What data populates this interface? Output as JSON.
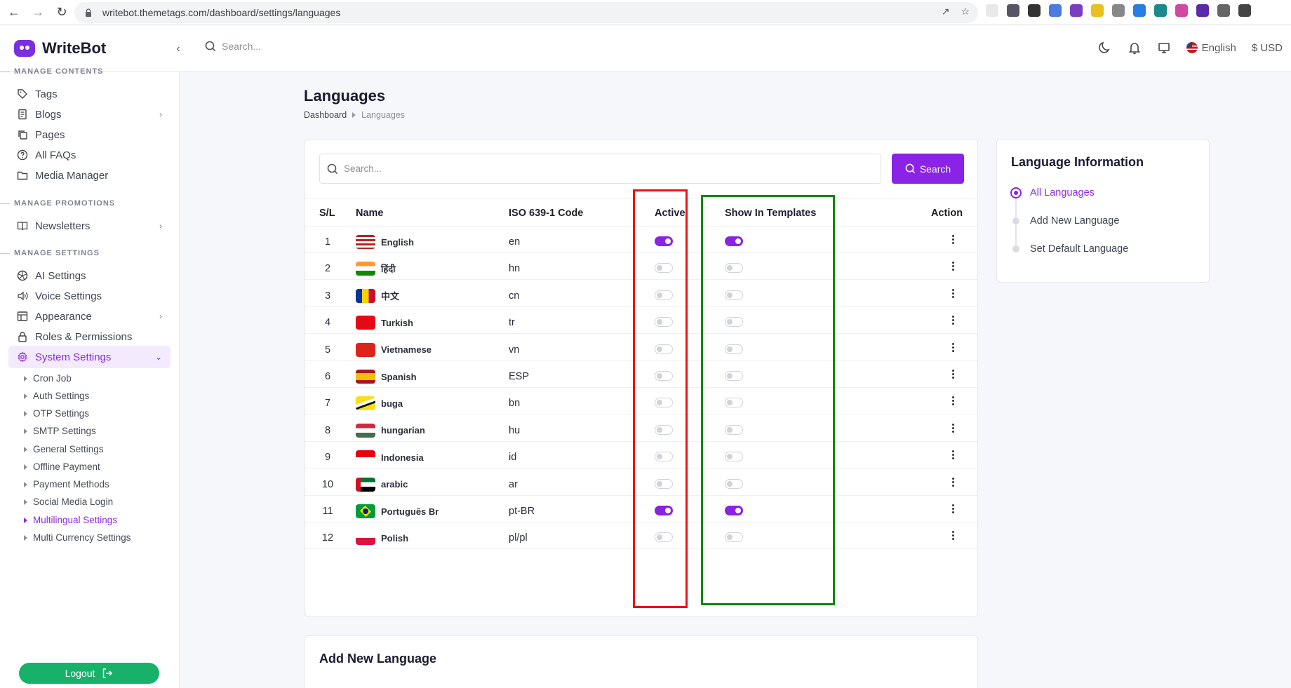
{
  "browser": {
    "url": "writebot.themetags.com/dashboard/settings/languages"
  },
  "header": {
    "brand": "WriteBot",
    "search_placeholder": "Search...",
    "language": "English",
    "currency": "$ USD"
  },
  "sidebar": {
    "sections": {
      "contents": "MANAGE CONTENTS",
      "promotions": "MANAGE PROMOTIONS",
      "settings": "MANAGE SETTINGS"
    },
    "items": {
      "tags": "Tags",
      "blogs": "Blogs",
      "pages": "Pages",
      "faqs": "All FAQs",
      "media": "Media Manager",
      "newsletters": "Newsletters",
      "ai": "AI Settings",
      "voice": "Voice Settings",
      "appearance": "Appearance",
      "roles": "Roles & Permissions",
      "system": "System Settings"
    },
    "subitems": [
      "Cron Job",
      "Auth Settings",
      "OTP Settings",
      "SMTP Settings",
      "General Settings",
      "Offline Payment",
      "Payment Methods",
      "Social Media Login",
      "Multilingual Settings",
      "Multi Currency Settings"
    ],
    "logout": "Logout"
  },
  "main": {
    "title": "Languages",
    "breadcrumb": {
      "home": "Dashboard",
      "current": "Languages"
    },
    "search_placeholder": "Search...",
    "search_button": "Search",
    "columns": {
      "sl": "S/L",
      "name": "Name",
      "code": "ISO 639-1 Code",
      "active": "Active",
      "templates": "Show In Templates",
      "action": "Action"
    },
    "rows": [
      {
        "sl": "1",
        "name": "English",
        "code": "en",
        "active": true,
        "templates": true
      },
      {
        "sl": "2",
        "name": "हिंदी",
        "code": "hn",
        "active": false,
        "templates": false
      },
      {
        "sl": "3",
        "name": "中文",
        "code": "cn",
        "active": false,
        "templates": false
      },
      {
        "sl": "4",
        "name": "Turkish",
        "code": "tr",
        "active": false,
        "templates": false
      },
      {
        "sl": "5",
        "name": "Vietnamese",
        "code": "vn",
        "active": false,
        "templates": false
      },
      {
        "sl": "6",
        "name": "Spanish",
        "code": "ESP",
        "active": false,
        "templates": false
      },
      {
        "sl": "7",
        "name": "buga",
        "code": "bn",
        "active": false,
        "templates": false
      },
      {
        "sl": "8",
        "name": "hungarian",
        "code": "hu",
        "active": false,
        "templates": false
      },
      {
        "sl": "9",
        "name": "Indonesia",
        "code": "id",
        "active": false,
        "templates": false
      },
      {
        "sl": "10",
        "name": "arabic",
        "code": "ar",
        "active": false,
        "templates": false
      },
      {
        "sl": "11",
        "name": "Português Br",
        "code": "pt-BR",
        "active": true,
        "templates": true
      },
      {
        "sl": "12",
        "name": "Polish",
        "code": "pl/pl",
        "active": false,
        "templates": false
      }
    ],
    "add_title": "Add New Language"
  },
  "info": {
    "title": "Language Information",
    "steps": [
      "All Languages",
      "Add New Language",
      "Set Default Language"
    ]
  },
  "colors": {
    "accent": "#8a23e6",
    "logout": "#17b169",
    "highlight_red": "#e11111",
    "highlight_green": "#0a8a0a"
  }
}
